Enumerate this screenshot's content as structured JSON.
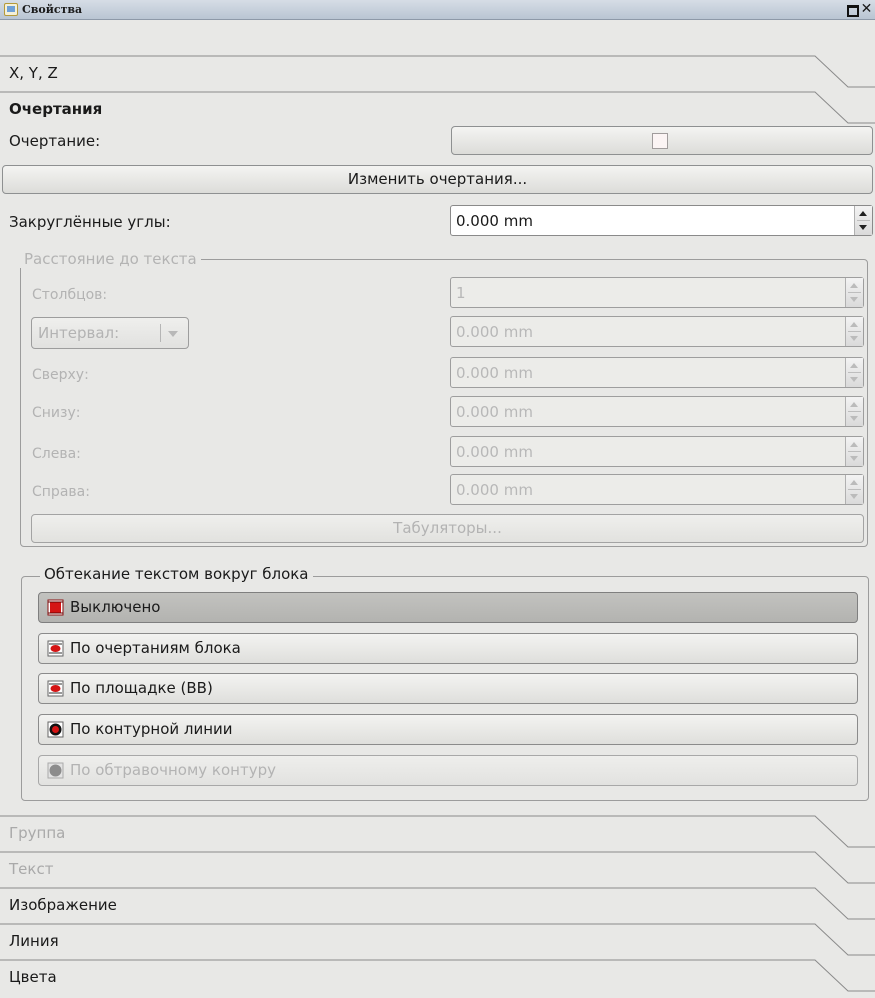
{
  "window": {
    "title": "Свойства"
  },
  "sections_top": [
    {
      "label": "X, Y, Z"
    },
    {
      "label": "Очертания"
    }
  ],
  "shape": {
    "label": "Очертание:",
    "edit_button": "Изменить очертания...",
    "rounded_corners_label": "Закруглённые углы:",
    "rounded_corners_value": "0.000 mm"
  },
  "text_distance": {
    "title": "Расстояние до текста",
    "columns_label": "Столбцов:",
    "columns_value": "1",
    "gap_dropdown": "Интервал:",
    "gap_value": "0.000 mm",
    "top_label": "Сверху:",
    "top_value": "0.000 mm",
    "bottom_label": "Снизу:",
    "bottom_value": "0.000 mm",
    "left_label": "Слева:",
    "left_value": "0.000 mm",
    "right_label": "Справа:",
    "right_value": "0.000 mm",
    "tabs_button": "Табуляторы..."
  },
  "text_flow": {
    "title": "Обтекание текстом вокруг блока",
    "options": [
      {
        "label": "Выключено",
        "state": "active"
      },
      {
        "label": "По очертаниям блока",
        "state": "normal"
      },
      {
        "label": "По площадке (BB)",
        "state": "normal"
      },
      {
        "label": "По контурной линии",
        "state": "normal"
      },
      {
        "label": "По обтравочному контуру",
        "state": "disabled"
      }
    ]
  },
  "sections_bottom": [
    {
      "label": "Группа",
      "state": "disabled"
    },
    {
      "label": "Текст",
      "state": "disabled"
    },
    {
      "label": "Изображение",
      "state": "normal"
    },
    {
      "label": "Линия",
      "state": "normal"
    },
    {
      "label": "Цвета",
      "state": "normal"
    }
  ],
  "colors": {
    "active_button": "#b7b7b4",
    "disabled_text": "#b3b3b3",
    "icon_red": "#cc1111"
  }
}
